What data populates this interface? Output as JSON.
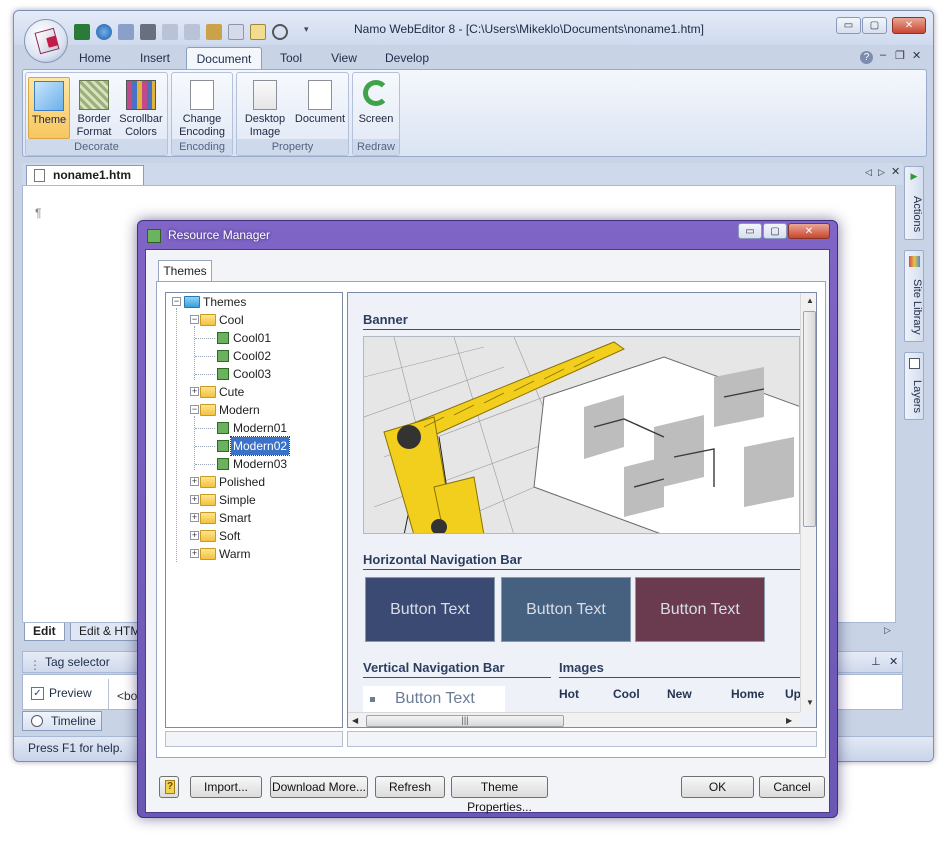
{
  "app": {
    "title": "Namo WebEditor 8 - [C:\\Users\\Mikeklo\\Documents\\noname1.htm]",
    "menu_tabs": [
      "Home",
      "Insert",
      "Document",
      "Tool",
      "View",
      "Develop"
    ],
    "active_tab": "Document",
    "ribbon": {
      "groups": [
        {
          "label": "Decorate",
          "buttons": [
            "Theme",
            "Border\nFormat",
            "Scrollbar\nColors"
          ]
        },
        {
          "label": "Encoding",
          "buttons": [
            "Change\nEncoding"
          ]
        },
        {
          "label": "Property",
          "buttons": [
            "Desktop\nImage",
            "Document"
          ]
        },
        {
          "label": "Redraw",
          "buttons": [
            "Screen"
          ]
        }
      ],
      "b0": "Theme",
      "b1a": "Border",
      "b1b": "Format",
      "b2a": "Scrollbar",
      "b2b": "Colors",
      "b3a": "Change",
      "b3b": "Encoding",
      "b4a": "Desktop",
      "b4b": "Image",
      "b5": "Document",
      "b6": "Screen",
      "g0": "Decorate",
      "g1": "Encoding",
      "g2": "Property",
      "g3": "Redraw"
    },
    "doc_tab": "noname1.htm",
    "editor_mark": "¶",
    "side_tabs": {
      "actions": "Actions",
      "site_library": "Site Library",
      "layers": "Layers"
    },
    "view_tabs": {
      "edit": "Edit",
      "edit_html": "Edit & HTML"
    },
    "tag_selector": {
      "title": "Tag selector",
      "preview_label": "Preview",
      "preview_checked": true,
      "tag_text": "<bod"
    },
    "timeline_tab": "Timeline",
    "status_text": "Press F1 for help.",
    "window_buttons": {
      "min": "▭",
      "max": "▢",
      "close": "✕"
    }
  },
  "dialog": {
    "title": "Resource Manager",
    "tab": "Themes",
    "tree": {
      "root": "Themes",
      "cool": "Cool",
      "cool01": "Cool01",
      "cool02": "Cool02",
      "cool03": "Cool03",
      "cute": "Cute",
      "modern": "Modern",
      "modern01": "Modern01",
      "modern02": "Modern02",
      "modern03": "Modern03",
      "polished": "Polished",
      "simple": "Simple",
      "smart": "Smart",
      "soft": "Soft",
      "warm": "Warm",
      "selected": "Modern02"
    },
    "preview": {
      "banner_title": "Banner",
      "hnav_title": "Horizontal Navigation Bar",
      "hnav_buttons": [
        {
          "label": "Button Text",
          "color": "#3b4a72"
        },
        {
          "label": "Button Text",
          "color": "#46607f"
        },
        {
          "label": "Button Text",
          "color": "#6a3b4e"
        }
      ],
      "vnav_title": "Vertical Navigation Bar",
      "vnav_item": "Button Text",
      "images_title": "Images",
      "images": [
        "Hot",
        "Cool",
        "New",
        "Home",
        "Up"
      ]
    },
    "buttons": {
      "help": "?",
      "import": "Import...",
      "download": "Download More...",
      "refresh": "Refresh",
      "theme_props": "Theme Properties...",
      "ok": "OK",
      "cancel": "Cancel"
    }
  },
  "colors": {
    "accent": "#3a71c9",
    "dialog_frame": "#7561bf"
  }
}
